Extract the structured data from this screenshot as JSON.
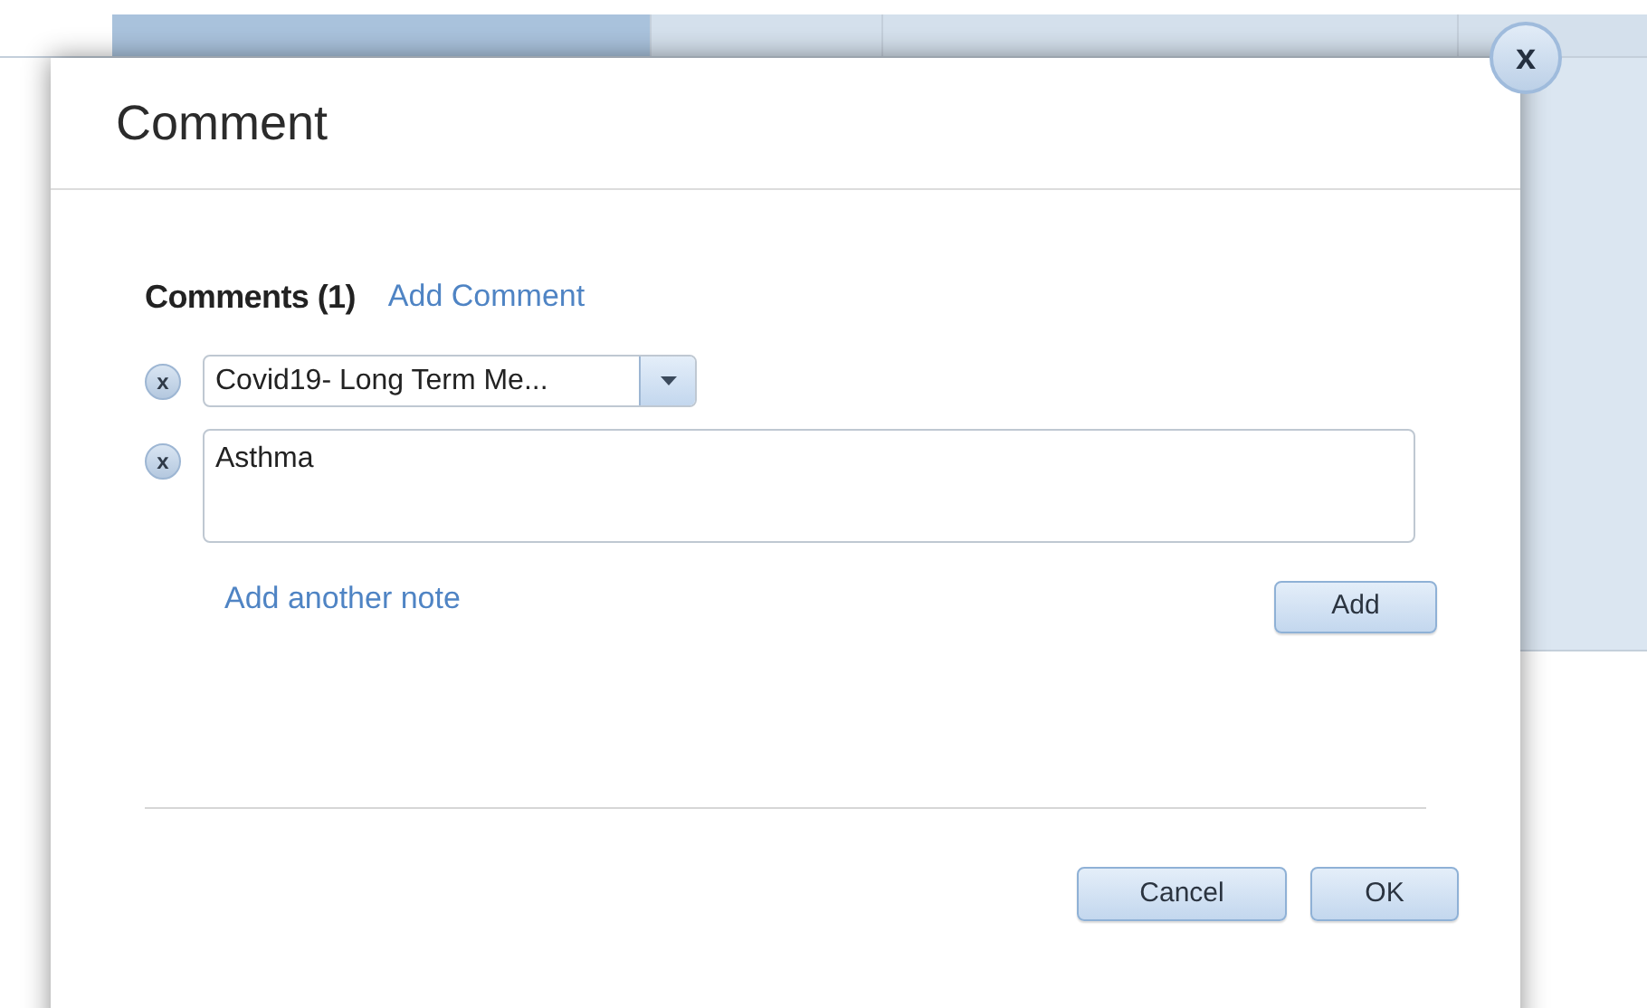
{
  "dialog": {
    "title": "Comment",
    "close": "x"
  },
  "comments_heading": "Comments (1)",
  "add_comment_link": "Add Comment",
  "comments": [
    {
      "kind": "dropdown",
      "remove": "x",
      "value": "Covid19- Long Term Me..."
    },
    {
      "kind": "textarea",
      "remove": "x",
      "value": "Asthma"
    }
  ],
  "add_note_link": "Add another note",
  "add_button": "Add",
  "buttons": [
    "Cancel",
    "OK"
  ]
}
